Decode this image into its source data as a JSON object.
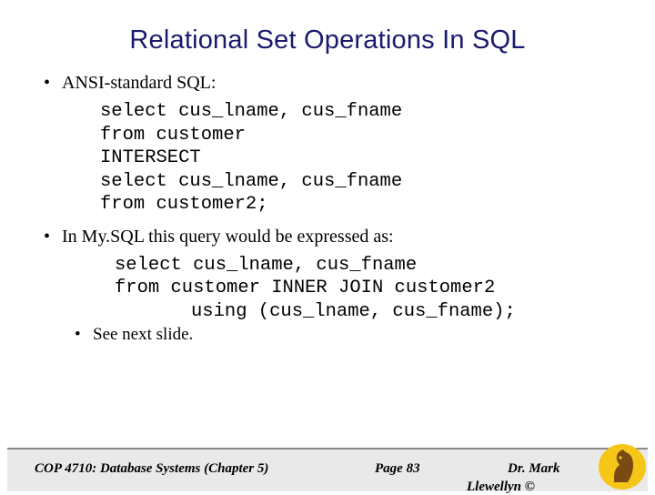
{
  "slide": {
    "title": "Relational Set Operations In SQL",
    "bullets": [
      {
        "marker": "•",
        "text": "ANSI-standard SQL:"
      },
      {
        "marker": "•",
        "text": "In My.SQL this query would be expressed as:"
      },
      {
        "marker": "•",
        "text": "See next slide."
      }
    ],
    "code_block_1": [
      "select cus_lname, cus_fname",
      "from customer",
      "INTERSECT",
      "select cus_lname, cus_fname",
      "from customer2;"
    ],
    "code_block_2": [
      "select cus_lname, cus_fname",
      "from customer INNER JOIN customer2",
      "using (cus_lname, cus_fname);"
    ]
  },
  "footer": {
    "left": "COP 4710: Database Systems  (Chapter 5)",
    "center": "Page 83",
    "right": "Dr. Mark",
    "right_second_line": "Llewellyn ©"
  }
}
